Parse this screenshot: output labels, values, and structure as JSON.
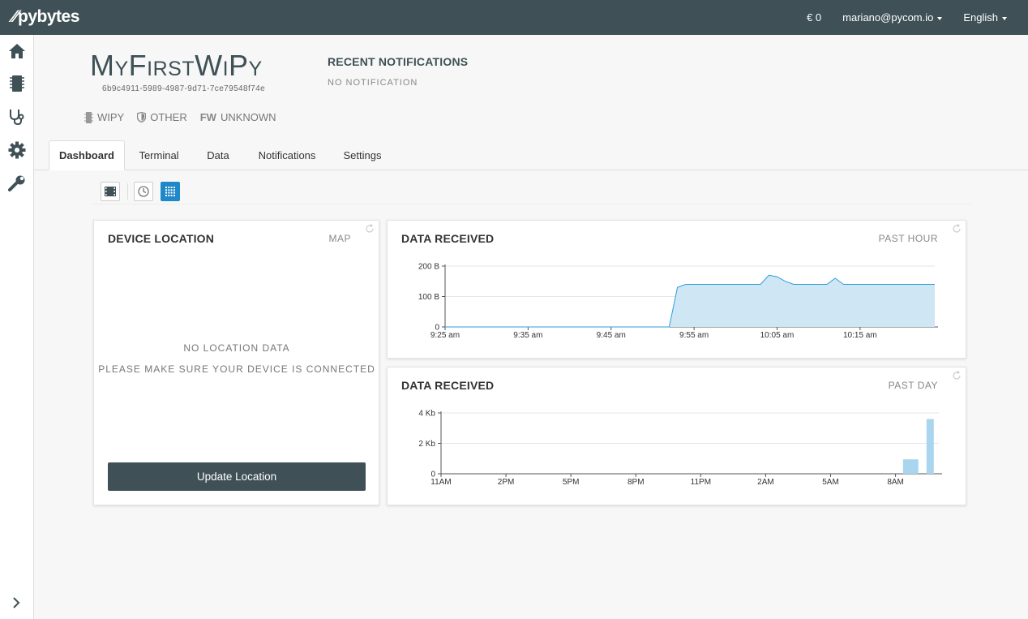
{
  "app": {
    "logo": "pybytes"
  },
  "topbar": {
    "balance": "€ 0",
    "user": "mariano@pycom.io",
    "language": "English"
  },
  "sidebar": {
    "items": [
      {
        "icon": "home-icon"
      },
      {
        "icon": "device-chip-icon"
      },
      {
        "icon": "stethoscope-icon"
      },
      {
        "icon": "gear-icon"
      },
      {
        "icon": "wrench-icon"
      }
    ]
  },
  "device": {
    "name": "MyFirstWiPy",
    "id": "6b9c4911-5989-4987-9d71-7ce79548f74e",
    "board": "WIPY",
    "network": "OTHER",
    "fw_label": "FW",
    "fw_value": "UNKNOWN"
  },
  "notifications": {
    "title": "RECENT NOTIFICATIONS",
    "empty": "NO NOTIFICATION"
  },
  "tabs": [
    {
      "label": "Dashboard",
      "active": true
    },
    {
      "label": "Terminal"
    },
    {
      "label": "Data"
    },
    {
      "label": "Notifications"
    },
    {
      "label": "Settings"
    }
  ],
  "location_card": {
    "title": "DEVICE LOCATION",
    "tag": "MAP",
    "msg1": "NO LOCATION DATA",
    "msg2": "PLEASE MAKE SURE YOUR DEVICE IS CONNECTED",
    "button": "Update Location"
  },
  "colors": {
    "accent": "#1e88c8",
    "header": "#3f5156",
    "area_fill": "#cfe6f5",
    "area_stroke": "#2f9ed8",
    "bar_fill": "#a9d5ef"
  },
  "chart_data": [
    {
      "type": "area",
      "title": "DATA RECEIVED",
      "tag": "PAST HOUR",
      "x_ticks": [
        "9:25 am",
        "9:35 am",
        "9:45 am",
        "9:55 am",
        "10:05 am",
        "10:15 am"
      ],
      "x_tick_minutes": [
        0,
        10,
        20,
        30,
        40,
        50
      ],
      "x_range": [
        0,
        59
      ],
      "y_ticks": [
        "0",
        "100 B",
        "200 B"
      ],
      "y_tick_values": [
        0,
        100,
        200
      ],
      "ylim": [
        0,
        200
      ],
      "x": [
        0,
        27,
        28,
        29,
        30,
        38,
        39,
        40,
        41,
        42,
        46,
        47,
        48,
        49,
        59
      ],
      "y": [
        0,
        0,
        130,
        140,
        140,
        140,
        170,
        165,
        150,
        140,
        140,
        160,
        140,
        140,
        140
      ]
    },
    {
      "type": "bar",
      "title": "DATA RECEIVED",
      "tag": "PAST DAY",
      "x_ticks": [
        "11AM",
        "2PM",
        "5PM",
        "8PM",
        "11PM",
        "2AM",
        "5AM",
        "8AM"
      ],
      "x_tick_hours": [
        0,
        3,
        6,
        9,
        12,
        15,
        18,
        21
      ],
      "x_range": [
        0,
        23
      ],
      "y_ticks": [
        "0",
        "2 Kb",
        "4 Kb"
      ],
      "y_tick_values": [
        0,
        2,
        4
      ],
      "ylim": [
        0,
        4
      ],
      "bars": [
        {
          "hour": 21.7,
          "value": 0.95
        },
        {
          "hour": 22.6,
          "value": 3.6
        }
      ]
    }
  ]
}
